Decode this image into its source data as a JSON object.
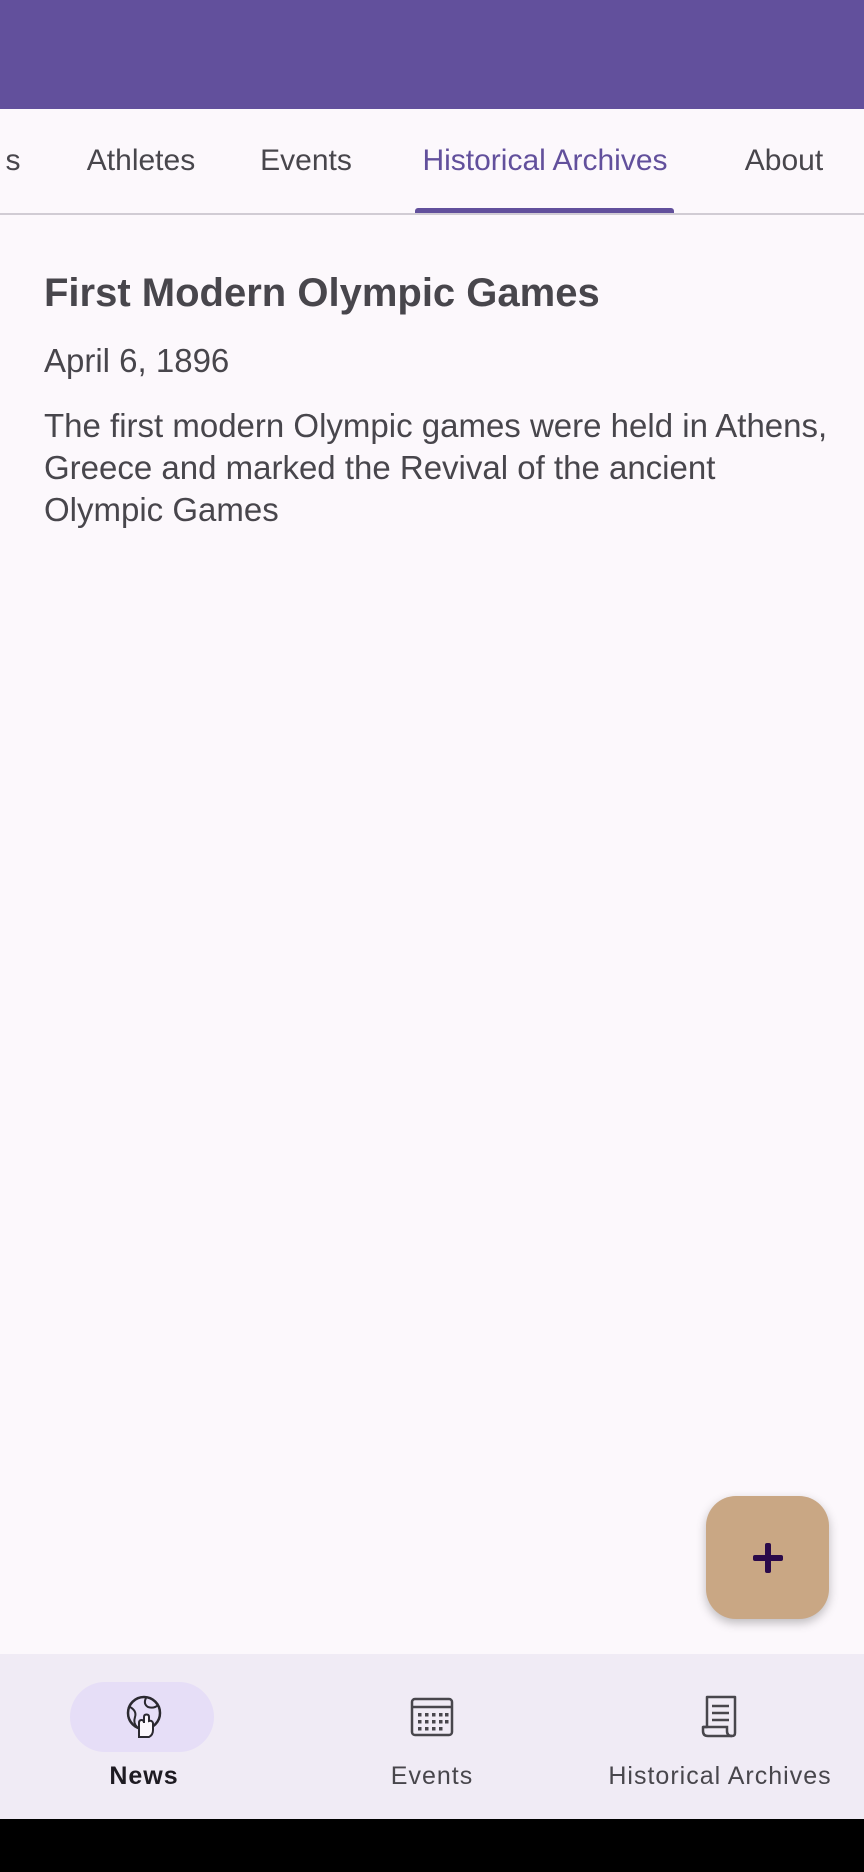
{
  "top_tabs": [
    {
      "label": "s",
      "active": false
    },
    {
      "label": "Athletes",
      "active": false
    },
    {
      "label": "Events",
      "active": false
    },
    {
      "label": "Historical Archives",
      "active": true
    },
    {
      "label": "About",
      "active": false
    }
  ],
  "article": {
    "title": "First Modern Olympic Games",
    "date": "April 6, 1896",
    "description": "The first modern Olympic games were held in Athens, Greece and marked the Revival of the ancient Olympic Games"
  },
  "fab": {
    "icon": "plus-icon"
  },
  "bottom_nav": [
    {
      "label": "News",
      "icon": "globe-hand-icon",
      "active": true
    },
    {
      "label": "Events",
      "icon": "calendar-icon",
      "active": false
    },
    {
      "label": "Historical Archives",
      "icon": "document-icon",
      "active": false
    }
  ],
  "colors": {
    "primary": "#62509c",
    "background": "#fcf8fc",
    "fab": "#c9a784",
    "nav_background": "#f0ebf5",
    "nav_active_pill": "#e6def7"
  }
}
